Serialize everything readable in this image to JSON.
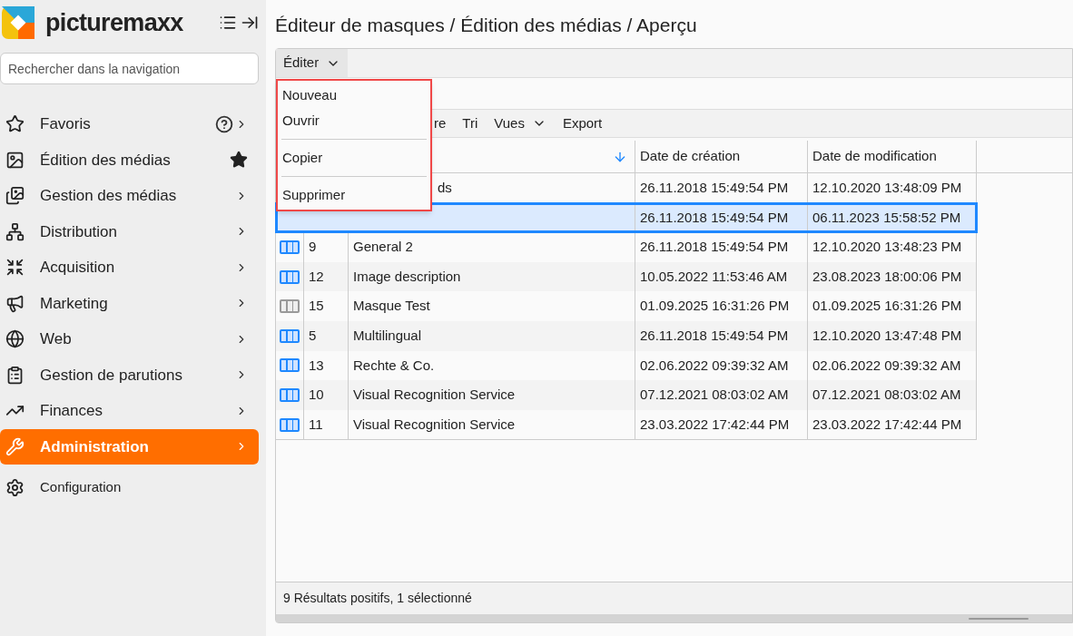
{
  "brand": "picturemaxx",
  "search": {
    "placeholder": "Rechercher dans la navigation"
  },
  "nav": [
    {
      "label": "Favoris",
      "kind": "help",
      "selected": false
    },
    {
      "label": "Édition des médias",
      "kind": "star",
      "selected": false
    },
    {
      "label": "Gestion des médias",
      "kind": "chevron",
      "selected": false
    },
    {
      "label": "Distribution",
      "kind": "chevron",
      "selected": false
    },
    {
      "label": "Acquisition",
      "kind": "chevron",
      "selected": false
    },
    {
      "label": "Marketing",
      "kind": "chevron",
      "selected": false
    },
    {
      "label": "Web",
      "kind": "chevron",
      "selected": false
    },
    {
      "label": "Gestion de parutions",
      "kind": "chevron",
      "selected": false
    },
    {
      "label": "Finances",
      "kind": "chevron",
      "selected": false
    },
    {
      "label": "Administration",
      "kind": "chevron",
      "selected": true
    }
  ],
  "config": "Configuration",
  "breadcrumb": "Éditeur de masques / Édition des médias / Aperçu",
  "edit_menu": {
    "label": "Éditer",
    "expanded": true,
    "items": [
      {
        "label": "Nouveau",
        "divider_before": false
      },
      {
        "label": "Ouvrir",
        "divider_before": false
      },
      {
        "label": "Copier",
        "divider_before": true
      },
      {
        "label": "Supprimer",
        "divider_before": true
      }
    ]
  },
  "toolbar": [
    {
      "label": "re",
      "has_menu": false
    },
    {
      "label": "Tri",
      "has_menu": false
    },
    {
      "label": "Vues",
      "has_menu": true
    },
    {
      "label": "Export",
      "has_menu": false
    }
  ],
  "table": {
    "columns": [
      "Date de création",
      "Date de modification"
    ],
    "sort_descending": true,
    "rows": [
      {
        "covered": true,
        "name": "ds",
        "created": "26.11.2018 15:49:54 PM",
        "modified": "12.10.2020 13:48:09 PM",
        "selected": false
      },
      {
        "covered": true,
        "created": "26.11.2018 15:49:54 PM",
        "modified": "06.11.2023 15:58:52 PM",
        "selected": true
      },
      {
        "covered": false,
        "enabled": true,
        "id": "9",
        "name": "General 2",
        "created": "26.11.2018 15:49:54 PM",
        "modified": "12.10.2020 13:48:23 PM",
        "selected": false
      },
      {
        "covered": false,
        "enabled": true,
        "id": "12",
        "name": "Image description",
        "created": "10.05.2022 11:53:46 AM",
        "modified": "23.08.2023 18:00:06 PM",
        "selected": false
      },
      {
        "covered": false,
        "enabled": false,
        "id": "15",
        "name": "Masque Test",
        "created": "01.09.2025 16:31:26 PM",
        "modified": "01.09.2025 16:31:26 PM",
        "selected": false
      },
      {
        "covered": false,
        "enabled": true,
        "id": "5",
        "name": "Multilingual",
        "created": "26.11.2018 15:49:54 PM",
        "modified": "12.10.2020 13:47:48 PM",
        "selected": false
      },
      {
        "covered": false,
        "enabled": true,
        "id": "13",
        "name": "Rechte & Co.",
        "created": "02.06.2022 09:39:32 AM",
        "modified": "02.06.2022 09:39:32 AM",
        "selected": false
      },
      {
        "covered": false,
        "enabled": true,
        "id": "10",
        "name": "Visual Recognition Service",
        "created": "07.12.2021 08:03:02 AM",
        "modified": "07.12.2021 08:03:02 AM",
        "selected": false
      },
      {
        "covered": false,
        "enabled": true,
        "id": "11",
        "name": "Visual Recognition Service",
        "created": "23.03.2022 17:42:44 PM",
        "modified": "23.03.2022 17:42:44 PM",
        "selected": false
      }
    ]
  },
  "status": "9 Résultats positifs, 1 sélectionné"
}
